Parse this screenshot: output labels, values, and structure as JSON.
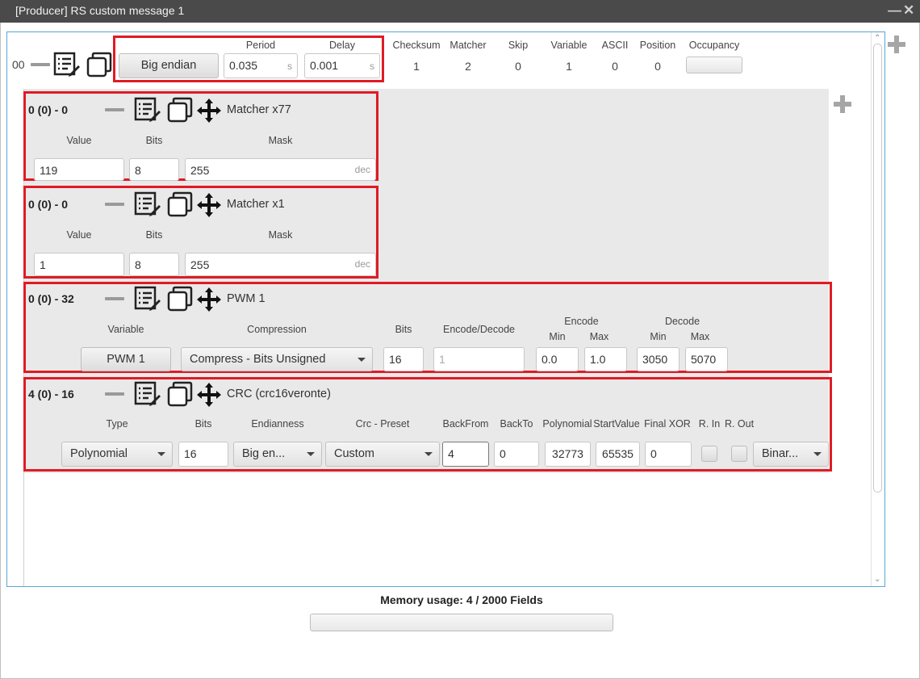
{
  "window": {
    "title": "[Producer] RS custom message 1",
    "minimize": "—",
    "close": "✕"
  },
  "header": {
    "index": "00",
    "endian_button": "Big endian",
    "period": {
      "label": "Period",
      "value": "0.035",
      "unit": "s"
    },
    "delay": {
      "label": "Delay",
      "value": "0.001",
      "unit": "s"
    },
    "stats": [
      {
        "label": "Checksum",
        "value": "1"
      },
      {
        "label": "Matcher",
        "value": "2"
      },
      {
        "label": "Skip",
        "value": "0"
      },
      {
        "label": "Variable",
        "value": "1"
      },
      {
        "label": "ASCII",
        "value": "0"
      },
      {
        "label": "Position",
        "value": "0"
      }
    ],
    "occupancy_label": "Occupancy"
  },
  "matcher1": {
    "id": "0 (0) - 0",
    "name": "Matcher x77",
    "value_label": "Value",
    "bits_label": "Bits",
    "mask_label": "Mask",
    "value": "119",
    "bits": "8",
    "mask": "255",
    "mask_unit": "dec"
  },
  "matcher2": {
    "id": "0 (0) - 0",
    "name": "Matcher x1",
    "value_label": "Value",
    "bits_label": "Bits",
    "mask_label": "Mask",
    "value": "1",
    "bits": "8",
    "mask": "255",
    "mask_unit": "dec"
  },
  "pwm": {
    "id": "0 (0) - 32",
    "name": "PWM 1",
    "variable_label": "Variable",
    "compression_label": "Compression",
    "bits_label": "Bits",
    "encdec_label": "Encode/Decode",
    "encode_label": "Encode",
    "decode_label": "Decode",
    "min_label": "Min",
    "max_label": "Max",
    "variable": "PWM 1",
    "compression": "Compress - Bits Unsigned",
    "bits": "16",
    "encdec_placeholder": "1",
    "encode_min": "0.0",
    "encode_max": "1.0",
    "decode_min": "3050",
    "decode_max": "5070"
  },
  "crc": {
    "id": "4 (0) - 16",
    "name": "CRC (crc16veronte)",
    "labels": {
      "type": "Type",
      "bits": "Bits",
      "endianness": "Endianness",
      "preset": "Crc - Preset",
      "backfrom": "BackFrom",
      "backto": "BackTo",
      "polynomial": "Polynomial",
      "startvalue": "StartValue",
      "finalxor": "Final XOR",
      "rin": "R. In",
      "rout": "R. Out"
    },
    "type": "Polynomial",
    "bits": "16",
    "endianness": "Big en...",
    "preset": "Custom",
    "backfrom": "4",
    "backto": "0",
    "polynomial": "32773",
    "startvalue": "65535",
    "finalxor": "0",
    "format": "Binar..."
  },
  "memory": {
    "text": "Memory usage: 4 / 2000 Fields"
  }
}
